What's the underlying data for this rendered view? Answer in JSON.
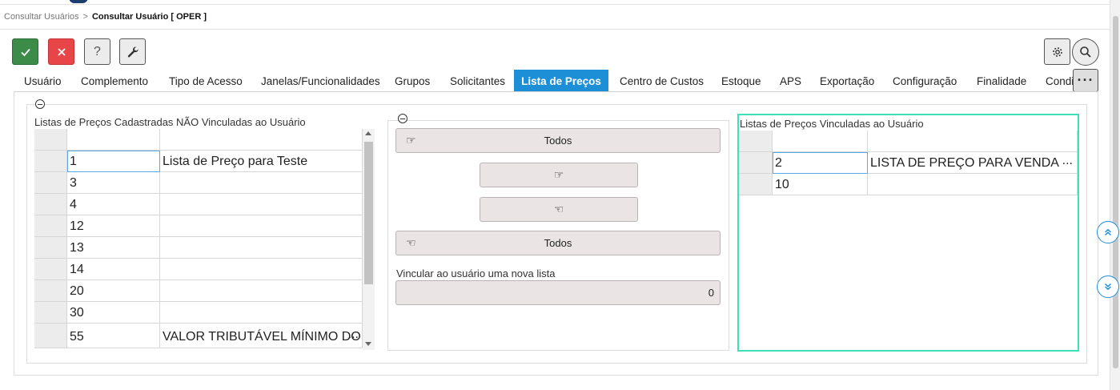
{
  "breadcrumb": {
    "parent": "Consultar Usuários",
    "separator": ">",
    "current": "Consultar Usuário [ OPER ]"
  },
  "toolbar": {
    "confirm_icon": "check-icon",
    "cancel_icon": "close-icon",
    "help_label": "?",
    "tools_icon": "wrench-icon",
    "settings_icon": "gear-icon",
    "search_icon": "search-icon"
  },
  "tabs": [
    {
      "label": "Usuário"
    },
    {
      "label": "Complemento"
    },
    {
      "label": "Tipo de Acesso"
    },
    {
      "label": "Janelas/Funcionalidades"
    },
    {
      "label": "Grupos"
    },
    {
      "label": "Solicitantes"
    },
    {
      "label": "Lista de Preços",
      "active": true
    },
    {
      "label": "Centro de Custos"
    },
    {
      "label": "Estoque"
    },
    {
      "label": "APS"
    },
    {
      "label": "Exportação"
    },
    {
      "label": "Configuração"
    },
    {
      "label": "Finalidade"
    },
    {
      "label": "Condi"
    }
  ],
  "tabs_more_label": "···",
  "left_panel": {
    "title": "Listas de Preços Cadastradas NÃO Vinculadas ao Usuário",
    "rows": [
      {
        "code": "1",
        "name": "Lista de Preço para Teste"
      },
      {
        "code": "3",
        "name": ""
      },
      {
        "code": "4",
        "name": ""
      },
      {
        "code": "12",
        "name": ""
      },
      {
        "code": "13",
        "name": ""
      },
      {
        "code": "14",
        "name": ""
      },
      {
        "code": "20",
        "name": ""
      },
      {
        "code": "30",
        "name": ""
      },
      {
        "code": "55",
        "name": "VALOR TRIBUTÁVEL MÍNIMO DO IPI",
        "more": "..."
      }
    ]
  },
  "middle_panel": {
    "add_all_label": "Todos",
    "remove_all_label": "Todos",
    "new_list_label": "Vincular ao usuário uma nova lista",
    "new_list_value": "0",
    "icons": {
      "add_all": "hand-right-icon",
      "add_one": "hand-right-icon",
      "remove_one": "hand-left-icon",
      "remove_all": "hand-left-icon"
    }
  },
  "right_panel": {
    "title": "Listas de Preços Vinculadas ao Usuário",
    "rows": [
      {
        "code": "2",
        "name": "LISTA DE PREÇO PARA VENDA",
        "more": "..."
      },
      {
        "code": "10",
        "name": ""
      }
    ]
  },
  "side_nav": {
    "up_icon": "double-chevron-up-icon",
    "down_icon": "double-chevron-down-icon"
  },
  "colors": {
    "accent": "#1c8fd6",
    "confirm": "#3d8b48",
    "cancel": "#e84549",
    "focus_frame": "#3de0b9"
  }
}
